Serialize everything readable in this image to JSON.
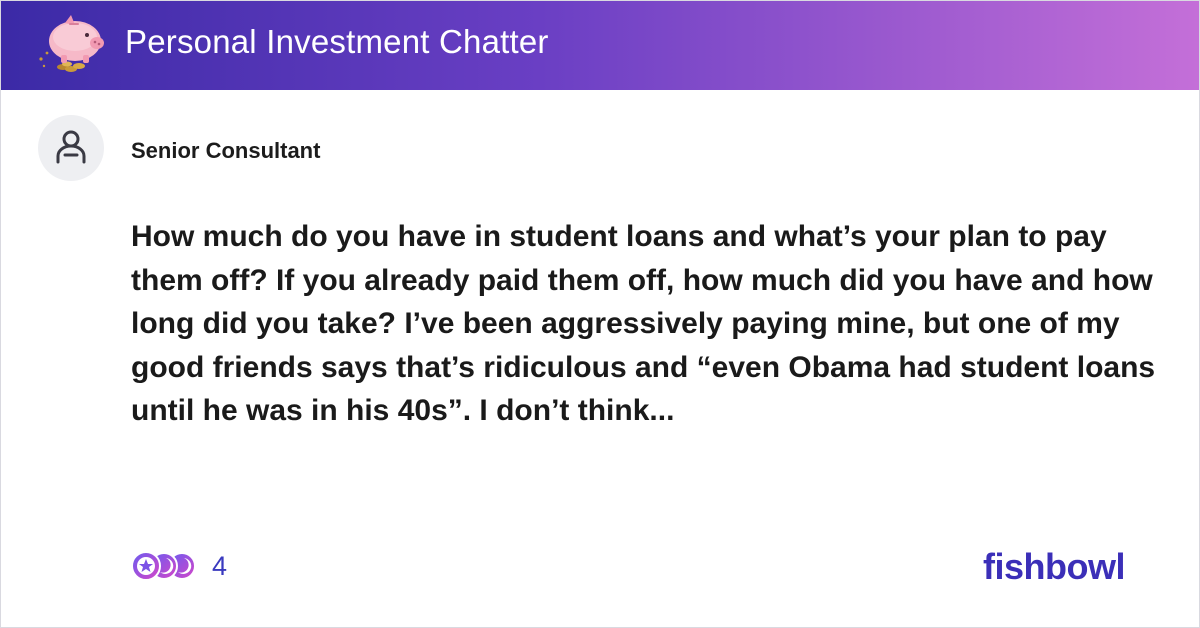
{
  "header": {
    "title": "Personal Investment Chatter",
    "logo_icon": "piggy-bank-icon",
    "gradient": [
      "#3b2aa6",
      "#6a3fc4",
      "#c46fd8"
    ]
  },
  "post": {
    "author": "Senior Consultant",
    "avatar_icon": "user-icon",
    "body": "How much do you have in student loans and what’s your plan to pay them off? If you already paid them off, how much did you have and how long did you take? I’ve been aggressively paying mine, but one of my good friends says that’s ridiculous and “even Obama had student loans until he was in his 40s”. I don’t think..."
  },
  "reactions": {
    "count": "4",
    "icons": [
      "star-reaction-icon",
      "moon-reaction-icon",
      "moon-reaction-icon"
    ]
  },
  "brand": {
    "name": "fishbowl",
    "color": "#3b2fb8"
  }
}
